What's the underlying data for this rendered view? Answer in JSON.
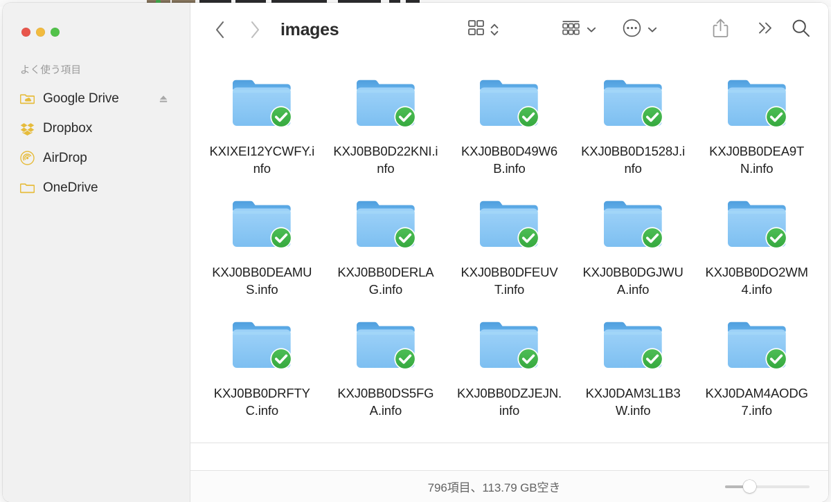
{
  "window": {
    "title": "images",
    "traffic_lights": [
      {
        "name": "close",
        "color": "#e8564c"
      },
      {
        "name": "minimize",
        "color": "#f2bb3f"
      },
      {
        "name": "maximize",
        "color": "#52c24a"
      }
    ]
  },
  "sidebar": {
    "section_title": "よく使う項目",
    "items": [
      {
        "label": "Google Drive",
        "icon": "google-drive-folder-icon",
        "eject": true
      },
      {
        "label": "Dropbox",
        "icon": "dropbox-icon",
        "eject": false
      },
      {
        "label": "AirDrop",
        "icon": "airdrop-icon",
        "eject": false
      },
      {
        "label": "OneDrive",
        "icon": "onedrive-folder-icon",
        "eject": false
      }
    ],
    "icon_color": "#e6bc3c"
  },
  "toolbar": {
    "back_icon": "chevron-left-icon",
    "forward_icon": "chevron-right-icon",
    "title": "images",
    "icon_view_icon": "grid-view-icon",
    "icon_view_caret": "chevron-updown-icon",
    "group_icon": "group-by-icon",
    "group_caret": "chevron-down-icon",
    "more_icon": "ellipsis-circle-icon",
    "more_caret": "chevron-down-icon",
    "share_icon": "share-icon",
    "overflow_icon": "double-chevron-right-icon",
    "search_icon": "search-icon"
  },
  "files": [
    {
      "name": "KXIXEI12YCWFY.info",
      "icon": "folder-checked-icon"
    },
    {
      "name": "KXJ0BB0D22KNI.info",
      "icon": "folder-checked-icon"
    },
    {
      "name": "KXJ0BB0D49W6B.info",
      "icon": "folder-checked-icon"
    },
    {
      "name": "KXJ0BB0D1528J.info",
      "icon": "folder-checked-icon"
    },
    {
      "name": "KXJ0BB0DEA9TN.info",
      "icon": "folder-checked-icon"
    },
    {
      "name": "KXJ0BB0DEAMUS.info",
      "icon": "folder-checked-icon"
    },
    {
      "name": "KXJ0BB0DERLAG.info",
      "icon": "folder-checked-icon"
    },
    {
      "name": "KXJ0BB0DFEUVT.info",
      "icon": "folder-checked-icon"
    },
    {
      "name": "KXJ0BB0DGJWUA.info",
      "icon": "folder-checked-icon"
    },
    {
      "name": "KXJ0BB0DO2WM4.info",
      "icon": "folder-checked-icon"
    },
    {
      "name": "KXJ0BB0DRFTYC.info",
      "icon": "folder-checked-icon"
    },
    {
      "name": "KXJ0BB0DS5FGA.info",
      "icon": "folder-checked-icon"
    },
    {
      "name": "KXJ0BB0DZJEJN.info",
      "icon": "folder-checked-icon"
    },
    {
      "name": "KXJ0DAM3L1B3W.info",
      "icon": "folder-checked-icon"
    },
    {
      "name": "KXJ0DAM4AODG7.info",
      "icon": "folder-checked-icon"
    }
  ],
  "statusbar": {
    "text": "796項目、113.79 GB空き",
    "zoom_percent": 25
  },
  "colors": {
    "folder_body": "#8cc8f5",
    "folder_tab": "#62aeea",
    "badge_green": "#36a93f",
    "sidebar_bg": "#f1f1f1",
    "accent_icon": "#e6bc3c"
  }
}
